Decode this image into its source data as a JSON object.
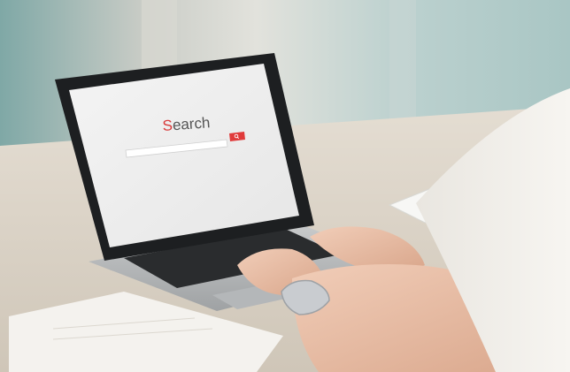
{
  "screen": {
    "logo_first": "S",
    "logo_rest": "earch",
    "search_placeholder": "",
    "top_right_text": "",
    "search_button_icon": "magnifier-icon",
    "accent": "#e03a3a"
  }
}
